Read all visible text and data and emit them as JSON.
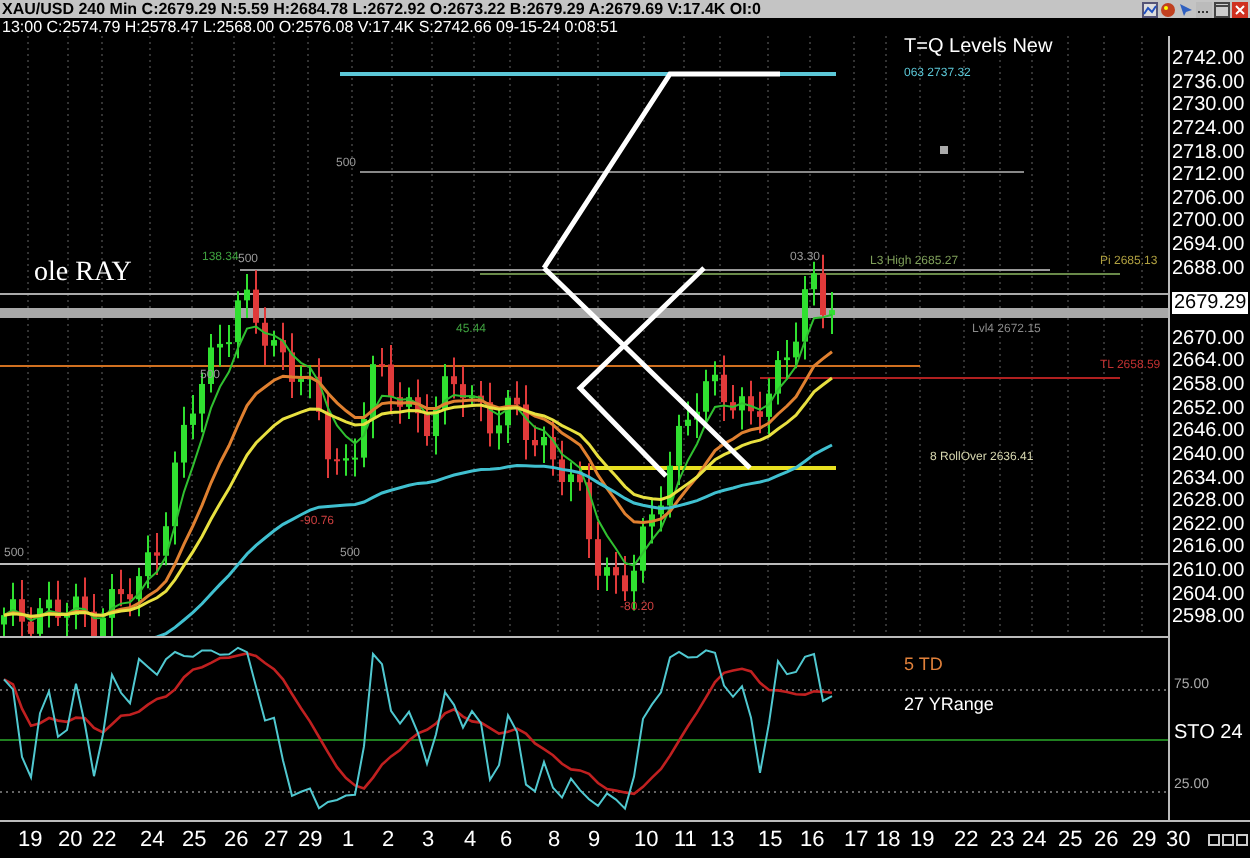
{
  "quote_bar": {
    "text": "XAU/USD 240 Min C:2679.29 N:5.59 H:2684.78 L:2672.92 O:2673.22 B:2679.29 A:2679.69 V:17.4K OI:0"
  },
  "bar_info": {
    "text": "13:00 C:2574.79 H:2578.47 L:2568.00 O:2576.08 V:17.4K S:2742.66 09-15-24 0:08:51"
  },
  "chart": {
    "title": "T=Q Levels New",
    "ray_label": "ole RAY",
    "level_labels": [
      {
        "text": "063 2737.32",
        "color": "#5cc8d8"
      },
      {
        "text": "500",
        "color": "#9a9a9a"
      },
      {
        "text": "138.34",
        "color": "#3fa03f"
      },
      {
        "text": "500",
        "color": "#9a9a9a"
      },
      {
        "text": "45.44",
        "color": "#3fa03f"
      },
      {
        "text": "03.30",
        "color": "#9a9a9a"
      },
      {
        "text": "L3 High 2685.27",
        "color": "#7fa05a"
      },
      {
        "text": "Pi 2685.13",
        "color": "#b0a040"
      },
      {
        "text": "Lvl4 2672.15",
        "color": "#8a8a8a"
      },
      {
        "text": "TL 2658.59",
        "color": "#c03030"
      },
      {
        "text": "500",
        "color": "#9a9a9a"
      },
      {
        "text": "-90.76",
        "color": "#d04040"
      },
      {
        "text": "500",
        "color": "#9a9a9a"
      },
      {
        "text": "500",
        "color": "#9a9a9a"
      },
      {
        "text": "-80.20",
        "color": "#d04040"
      },
      {
        "text": "8 RollOver 2636.41",
        "color": "#d8d8b0"
      }
    ]
  },
  "price_axis": {
    "ticks": [
      "2742.00",
      "2736.00",
      "2730.00",
      "2724.00",
      "2718.00",
      "2712.00",
      "2706.00",
      "2700.00",
      "2694.00",
      "2688.00",
      "2670.00",
      "2664.00",
      "2658.00",
      "2652.00",
      "2646.00",
      "2640.00",
      "2634.00",
      "2628.00",
      "2622.00",
      "2616.00",
      "2610.00",
      "2604.00",
      "2598.00"
    ],
    "current": "2679.29"
  },
  "oscillator": {
    "labels": [
      {
        "text": "5 TD",
        "color": "#e0803a"
      },
      {
        "text": "27 YRange",
        "color": "#ffffff"
      }
    ],
    "name": "STO 24",
    "ticks": [
      "75.00",
      "25.00"
    ]
  },
  "date_axis": [
    "19",
    "20",
    "22",
    "24",
    "25",
    "26",
    "27",
    "29",
    "1",
    "2",
    "3",
    "4",
    "6",
    "8",
    "9",
    "10",
    "11",
    "13",
    "15",
    "16",
    "17",
    "18",
    "19",
    "22",
    "23",
    "24",
    "25",
    "26",
    "29",
    "30"
  ]
}
